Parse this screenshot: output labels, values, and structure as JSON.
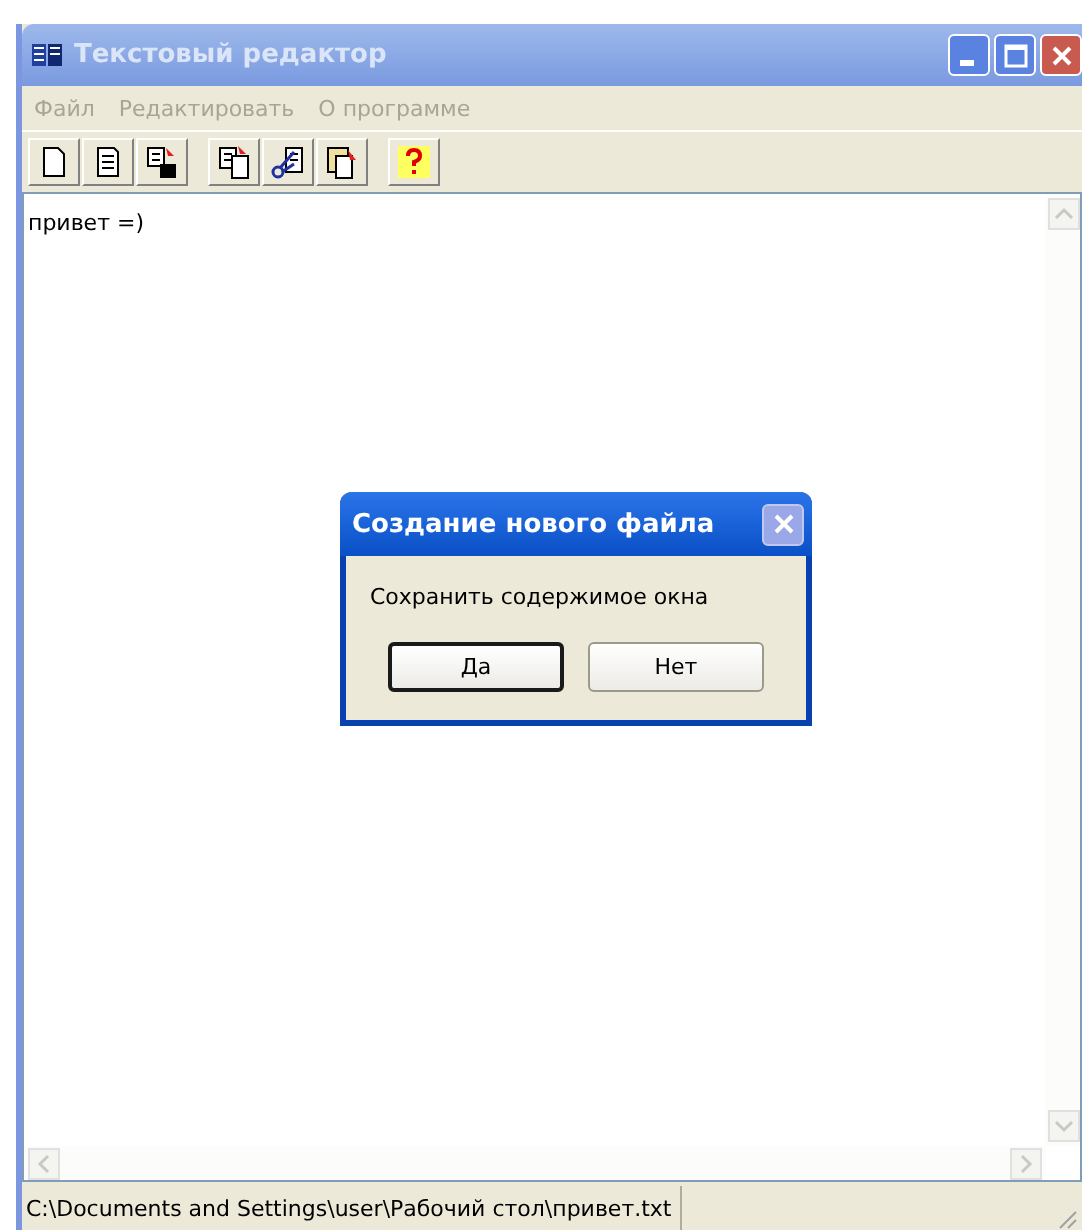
{
  "window": {
    "title": "Текстовый редактор",
    "active": false
  },
  "menu": [
    {
      "label": "Файл",
      "disabled": true
    },
    {
      "label": "Редактировать",
      "disabled": true
    },
    {
      "label": "О программе",
      "disabled": true
    }
  ],
  "toolbar": [
    {
      "buttons": [
        {
          "kind": "new"
        },
        {
          "kind": "open"
        },
        {
          "kind": "save"
        }
      ]
    },
    {
      "buttons": [
        {
          "kind": "copy"
        },
        {
          "kind": "cut"
        },
        {
          "kind": "paste"
        }
      ]
    },
    {
      "buttons": [
        {
          "kind": "help"
        }
      ]
    }
  ],
  "editor": {
    "text": "привет =)"
  },
  "dialog": {
    "title": "Создание нового файла",
    "message": "Сохранить содержимое окна",
    "buttons": [
      {
        "label": "Да",
        "selected": true
      },
      {
        "label": "Нет",
        "selected": false
      }
    ]
  },
  "status_bar": {
    "path": "C:\\Documents and Settings\\user\\Рабочий стол\\привет.txt"
  }
}
